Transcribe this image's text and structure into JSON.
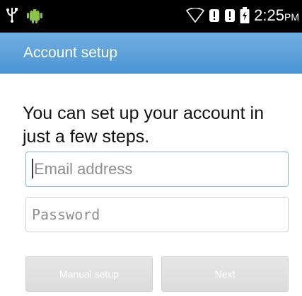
{
  "status_bar": {
    "time_main": "2:25",
    "time_suffix": "PM",
    "icons": [
      "usb-icon",
      "android-icon",
      "wifi-icon",
      "alert-icon",
      "alert-icon",
      "battery-icon"
    ]
  },
  "action_bar": {
    "title": "Account setup"
  },
  "intro": {
    "text": "You can set up your account in just a few steps."
  },
  "form": {
    "email_placeholder": "Email address",
    "password_placeholder": "Password"
  },
  "buttons": {
    "manual_setup": "Manual setup",
    "next": "Next"
  },
  "colors": {
    "accent": "#5a9fdb",
    "status_bar_bg": "#000000",
    "android_green": "#8bc34a"
  }
}
